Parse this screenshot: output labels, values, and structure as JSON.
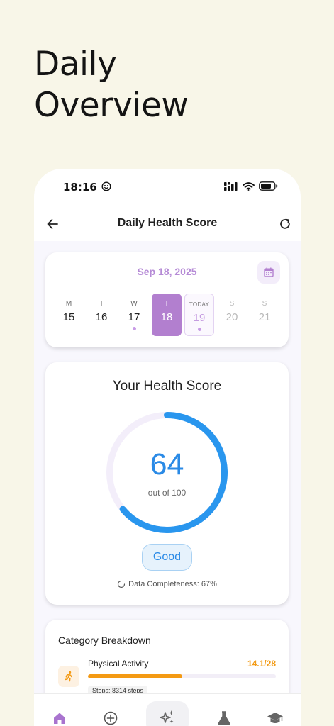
{
  "headline": {
    "line1": "Daily",
    "line2": "Overview"
  },
  "status_bar": {
    "time": "18:16"
  },
  "app_bar": {
    "title": "Daily Health Score"
  },
  "date_selector": {
    "selected_date": "Sep 18, 2025",
    "days": [
      {
        "label": "M",
        "number": "15",
        "state": "past",
        "has_data": false
      },
      {
        "label": "T",
        "number": "16",
        "state": "past",
        "has_data": false
      },
      {
        "label": "W",
        "number": "17",
        "state": "past",
        "has_data": true
      },
      {
        "label": "T",
        "number": "18",
        "state": "selected",
        "has_data": false
      },
      {
        "label": "TODAY",
        "number": "19",
        "state": "today",
        "has_data": true
      },
      {
        "label": "S",
        "number": "20",
        "state": "future",
        "has_data": false
      },
      {
        "label": "S",
        "number": "21",
        "state": "future",
        "has_data": false
      }
    ]
  },
  "health_score": {
    "title": "Your Health Score",
    "score": 64,
    "max_label": "out of 100",
    "max": 100,
    "rating": "Good",
    "completeness_label": "Data Completeness: 67%"
  },
  "category_breakdown": {
    "title": "Category Breakdown",
    "items": [
      {
        "name": "Physical Activity",
        "value_label": "14.1/28",
        "value": 14.1,
        "max": 28,
        "detail": "Steps: 8314 steps"
      }
    ]
  },
  "bottom_nav": {
    "items": [
      {
        "icon": "home-icon",
        "active": true
      },
      {
        "icon": "plus-circle-icon",
        "active": false
      },
      {
        "icon": "sparkles-icon",
        "active": false,
        "center": true
      },
      {
        "icon": "flask-icon",
        "active": false
      },
      {
        "icon": "graduation-cap-icon",
        "active": false
      }
    ]
  },
  "colors": {
    "accent_purple": "#b27fcf",
    "score_blue": "#2a8ae6",
    "activity_orange": "#f49a13",
    "background": "#f8f6e8"
  }
}
